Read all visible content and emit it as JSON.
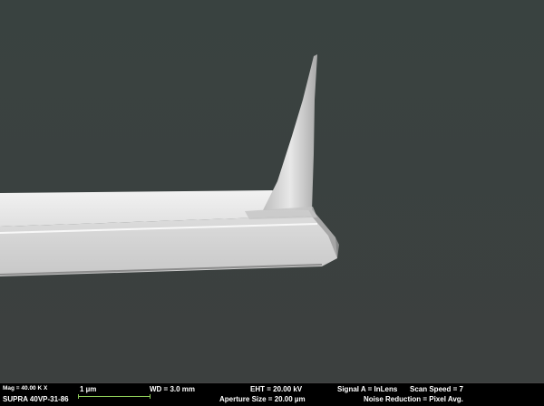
{
  "databar": {
    "magnification": "Mag = 40.00 K X",
    "instrument": "SUPRA 40VP-31-86",
    "scale_label": "1 µm",
    "working_distance": "WD = 3.0 mm",
    "eht": "EHT = 20.00 kV",
    "aperture": "Aperture Size = 20.00 µm",
    "signal": "Signal A = InLens",
    "scan_speed": "Scan Speed = 7",
    "noise_reduction": "Noise Reduction = Pixel Avg."
  },
  "colors": {
    "background": "#3a3f3e",
    "specimen": "#e6e6e6",
    "scalebar": "#8fcf5a"
  }
}
